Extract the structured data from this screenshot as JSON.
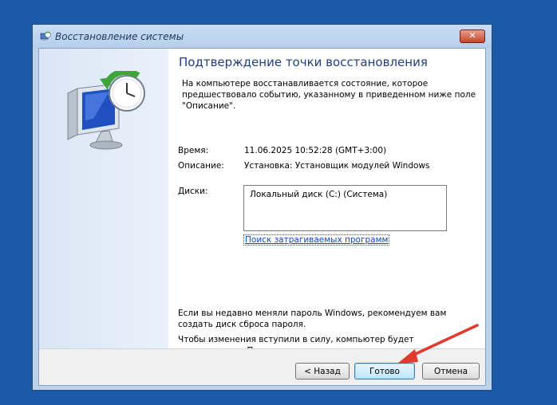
{
  "window": {
    "title": "Восстановление системы",
    "close_label": "✕"
  },
  "content": {
    "heading": "Подтверждение точки восстановления",
    "intro": "На компьютере восстанавливается состояние, которое предшествовало событию, указанному в приведенном ниже поле \"Описание\".",
    "time_label": "Время:",
    "time_value": "11.06.2025 10:52:28 (GMT+3:00)",
    "description_label": "Описание:",
    "description_value": "Установка: Установщик модулей Windows",
    "disks_label": "Диски:",
    "disks_items": [
      "Локальный диск (C:) (Система)"
    ],
    "scan_link": "Поиск затрагиваемых программ",
    "password_note": "Если вы недавно меняли пароль Windows, рекомендуем вам создать диск сброса пароля.",
    "restart_note": "Чтобы изменения вступили в силу, компьютер будет перезагружен. Прежде чем продолжить, сохраните все открытые файлы и закройте все программы."
  },
  "buttons": {
    "back": "< Назад",
    "finish": "Готово",
    "cancel": "Отмена"
  },
  "colors": {
    "desktop": "#1b5aa8",
    "heading": "#1f3f82",
    "link": "#0b4bb5",
    "annotation_arrow": "#e03a2e"
  },
  "icons": {
    "title": "system-restore-icon",
    "hero": "system-restore-monitor-icon",
    "annotation": "red-arrow"
  }
}
